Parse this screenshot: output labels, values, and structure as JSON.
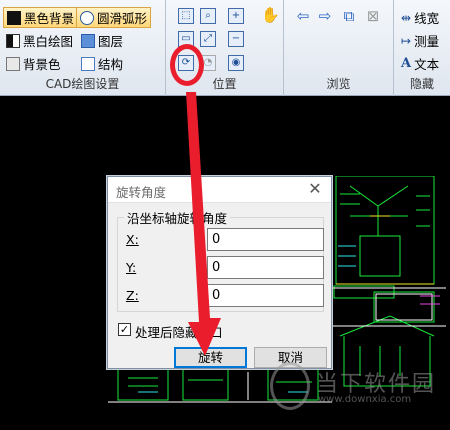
{
  "ribbon": {
    "cad_group": {
      "label": "CAD绘图设置",
      "buttons": [
        {
          "label": "黑色背景",
          "icon": "black-square-icon",
          "active": true
        },
        {
          "label": "圆滑弧形",
          "icon": "circle-icon",
          "active": true
        },
        {
          "label": "黑白绘图",
          "icon": "black-white-icon",
          "active": false
        },
        {
          "label": "图层",
          "icon": "layers-icon",
          "active": false
        },
        {
          "label": "背景色",
          "icon": "background-color-icon",
          "active": false
        },
        {
          "label": "结构",
          "icon": "structure-icon",
          "active": false
        }
      ]
    },
    "position_group": {
      "label": "位置"
    },
    "browse_group": {
      "label": "浏览"
    },
    "hide_group": {
      "label": "隐藏",
      "buttons": [
        {
          "label": "线宽",
          "icon": "line-width-icon"
        },
        {
          "label": "测量",
          "icon": "measure-icon"
        },
        {
          "label": "文本",
          "icon": "text-icon"
        }
      ]
    }
  },
  "dialog": {
    "title": "旋转角度",
    "close": "✕",
    "group_label": "沿坐标轴旋转角度",
    "fields": [
      {
        "label": "X:",
        "value": "0"
      },
      {
        "label": "Y:",
        "value": "0"
      },
      {
        "label": "Z:",
        "value": "0"
      }
    ],
    "checkbox_label": "处理后隐藏窗口",
    "checkbox_checked": "✓",
    "rotate_button": "旋转",
    "cancel_button": "取消"
  },
  "watermark": {
    "text": "当下软件园",
    "url": "www.downxia.com"
  },
  "colors": {
    "highlight": "#ea1d2c",
    "drawing": "#18e83a",
    "canvas": "#000000"
  }
}
